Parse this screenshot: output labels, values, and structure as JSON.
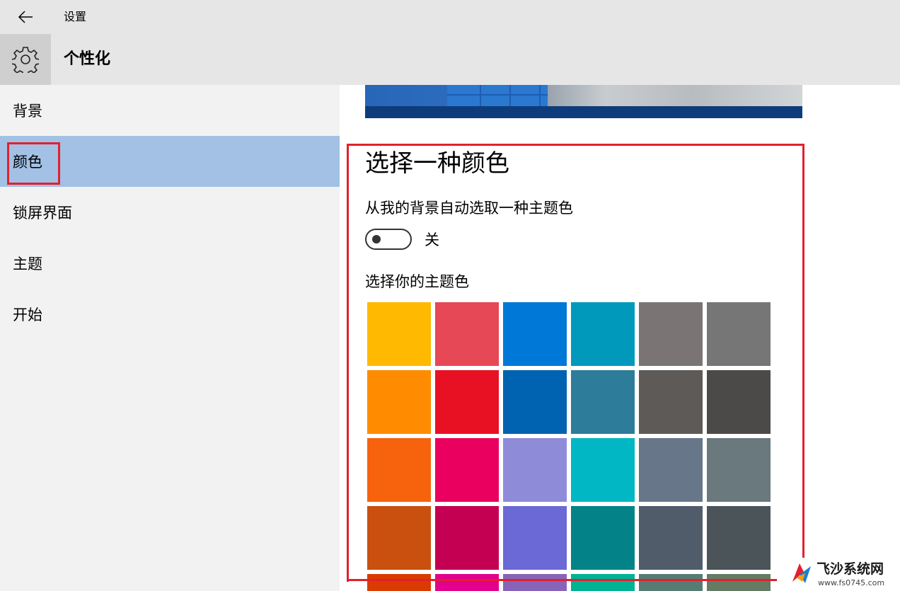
{
  "window": {
    "app_title": "设置",
    "back_icon": "back-arrow-icon"
  },
  "header": {
    "page_title": "个性化",
    "icon": "gear-icon"
  },
  "sidebar": {
    "items": [
      {
        "label": "背景",
        "selected": false
      },
      {
        "label": "颜色",
        "selected": true
      },
      {
        "label": "锁屏界面",
        "selected": false
      },
      {
        "label": "主题",
        "selected": false
      },
      {
        "label": "开始",
        "selected": false
      }
    ],
    "highlight_color": "#a2c1e5"
  },
  "colors": {
    "section_title": "选择一种颜色",
    "auto_pick_label": "从我的背景自动选取一种主题色",
    "auto_pick_toggle": {
      "state": false,
      "state_label": "关"
    },
    "accent_label": "选择你的主题色",
    "swatches": [
      [
        "#ffb900",
        "#e74856",
        "#0078d7",
        "#0099bc",
        "#7a7574",
        "#767676"
      ],
      [
        "#ff8c00",
        "#e81123",
        "#0063b1",
        "#2d7d9a",
        "#5d5a58",
        "#4c4a48"
      ],
      [
        "#f7630c",
        "#ea005e",
        "#8e8cd8",
        "#00b7c3",
        "#68768a",
        "#69797e"
      ],
      [
        "#ca5010",
        "#c30052",
        "#6b69d6",
        "#038387",
        "#515c6b",
        "#4a5459"
      ],
      [
        "#da3b01",
        "#e3008c",
        "#8764b8",
        "#00b294",
        "#567c73",
        "#647c64"
      ]
    ]
  },
  "annotation": {
    "highlight_color": "#e2202f"
  },
  "watermark": {
    "site_name": "飞沙系统网",
    "url": "www.fs0745.com"
  }
}
